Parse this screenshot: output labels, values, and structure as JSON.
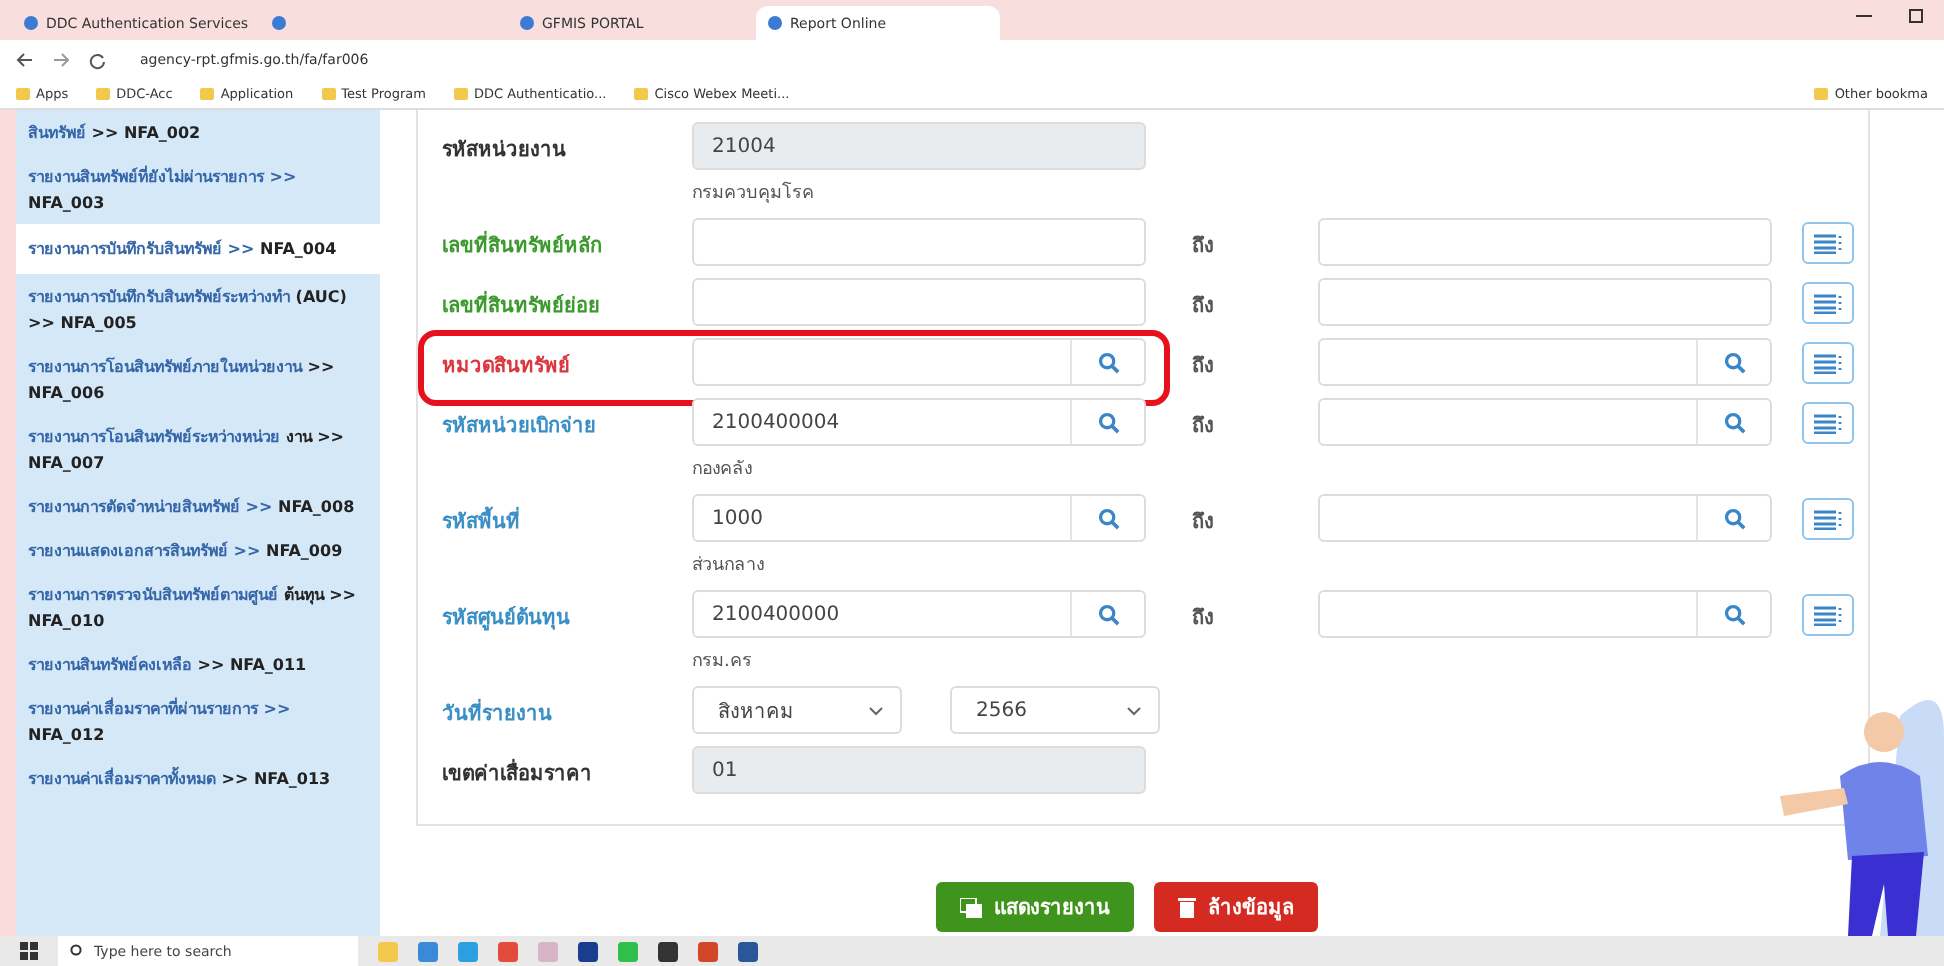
{
  "browser": {
    "tabs": [
      {
        "title": "DDC Authentication Services",
        "selected": false
      },
      {
        "selected": false
      },
      {
        "title": "GFMIS PORTAL",
        "selected": false
      },
      {
        "title": "Report Online",
        "selected": true
      }
    ],
    "address": "agency-rpt.gfmis.go.th/fa/far006",
    "bookmarks": [
      "Apps",
      "DDC-Acc",
      "Application",
      "Test Program",
      "DDC Authenticatio...",
      "Cisco Webex Meeti..."
    ],
    "other_bookmarks": "Other bookma"
  },
  "sidebar": {
    "items": [
      {
        "label": "สินทรัพย์",
        "code": ">> NFA_002",
        "selected": false
      },
      {
        "label": "รายงานสินทรัพย์ที่ยังไม่ผ่านรายการ >>",
        "code": "NFA_003",
        "selected": false
      },
      {
        "label": "รายงานการบันทึกรับสินทรัพย์ >>",
        "code": "NFA_004",
        "selected": true
      },
      {
        "label": "รายงานการบันทึกรับสินทรัพย์ระหว่างทำ",
        "code": "(AUC) >> NFA_005",
        "selected": false
      },
      {
        "label": "รายงานการโอนสินทรัพย์ภายในหน่วยงาน",
        "code": ">> NFA_006",
        "selected": false
      },
      {
        "label": "รายงานการโอนสินทรัพย์ระหว่างหน่วย",
        "code": "งาน >> NFA_007",
        "selected": false
      },
      {
        "label": "รายงานการตัดจำหน่ายสินทรัพย์ >>",
        "code": "NFA_008",
        "selected": false
      },
      {
        "label": "รายงานแสดงเอกสารสินทรัพย์ >>",
        "code": "NFA_009",
        "selected": false
      },
      {
        "label": "รายงานการตรวจนับสินทรัพย์ตามศูนย์",
        "code": "ต้นทุน >> NFA_010",
        "selected": false
      },
      {
        "label": "รายงานสินทรัพย์คงเหลือ",
        "code": ">> NFA_011",
        "selected": false
      },
      {
        "label": "รายงานค่าเสื่อมราคาที่ผ่านรายการ >>",
        "code": "NFA_012",
        "selected": false
      },
      {
        "label": "รายงานค่าเสื่อมราคาทั้งหมด",
        "code": ">> NFA_013",
        "selected": false
      }
    ]
  },
  "form": {
    "rows": [
      {
        "label": "รหัสหน่วยงาน",
        "color": "#333333",
        "highlighted": false,
        "field": {
          "kind": "readonly",
          "value": "21004"
        },
        "note": "กรมควบคุมโรค"
      },
      {
        "label": "เลขที่สินทรัพย์หลัก",
        "color": "#3c9a2e",
        "highlighted": false,
        "field": {
          "kind": "text"
        },
        "to": {
          "label": "ถึง",
          "field": {
            "kind": "text"
          }
        }
      },
      {
        "label": "เลขที่สินทรัพย์ย่อย",
        "color": "#3c9a2e",
        "highlighted": false,
        "field": {
          "kind": "text"
        },
        "to": {
          "label": "ถึง",
          "field": {
            "kind": "text"
          }
        }
      },
      {
        "label": "หมวดสินทรัพย์",
        "color": "#d9363e",
        "highlighted": true,
        "field": {
          "kind": "search"
        },
        "to": {
          "label": "ถึง",
          "field": {
            "kind": "search"
          }
        }
      },
      {
        "label": "รหัสหน่วยเบิกจ่าย",
        "color": "#3a8fc7",
        "highlighted": false,
        "field": {
          "kind": "search",
          "value": "2100400004"
        },
        "note": "กองคลัง",
        "to": {
          "label": "ถึง",
          "field": {
            "kind": "search"
          }
        }
      },
      {
        "label": "รหัสพื้นที่",
        "color": "#3a8fc7",
        "highlighted": false,
        "field": {
          "kind": "search",
          "value": "1000"
        },
        "note": "ส่วนกลาง",
        "to": {
          "label": "ถึง",
          "field": {
            "kind": "search"
          }
        }
      },
      {
        "label": "รหัสศูนย์ต้นทุน",
        "color": "#3a8fc7",
        "highlighted": false,
        "field": {
          "kind": "search",
          "value": "2100400000"
        },
        "note": "กรม.คร",
        "to": {
          "label": "ถึง",
          "field": {
            "kind": "search"
          }
        }
      },
      {
        "label": "วันที่รายงาน",
        "color": "#3a8fc7",
        "highlighted": false,
        "field": {
          "kind": "select",
          "value": "สิงหาคม"
        },
        "field2": {
          "kind": "select",
          "value": "2566"
        }
      },
      {
        "label": "เขตค่าเสื่อมราคา",
        "color": "#333333",
        "highlighted": false,
        "field": {
          "kind": "readonly",
          "value": "01"
        }
      }
    ]
  },
  "buttons": [
    {
      "kind": "show",
      "label": "แสดงรายงาน"
    },
    {
      "kind": "clear",
      "label": "ล้างข้อมูล"
    }
  ],
  "taskbar": {
    "search_placeholder": "Type here to search"
  }
}
